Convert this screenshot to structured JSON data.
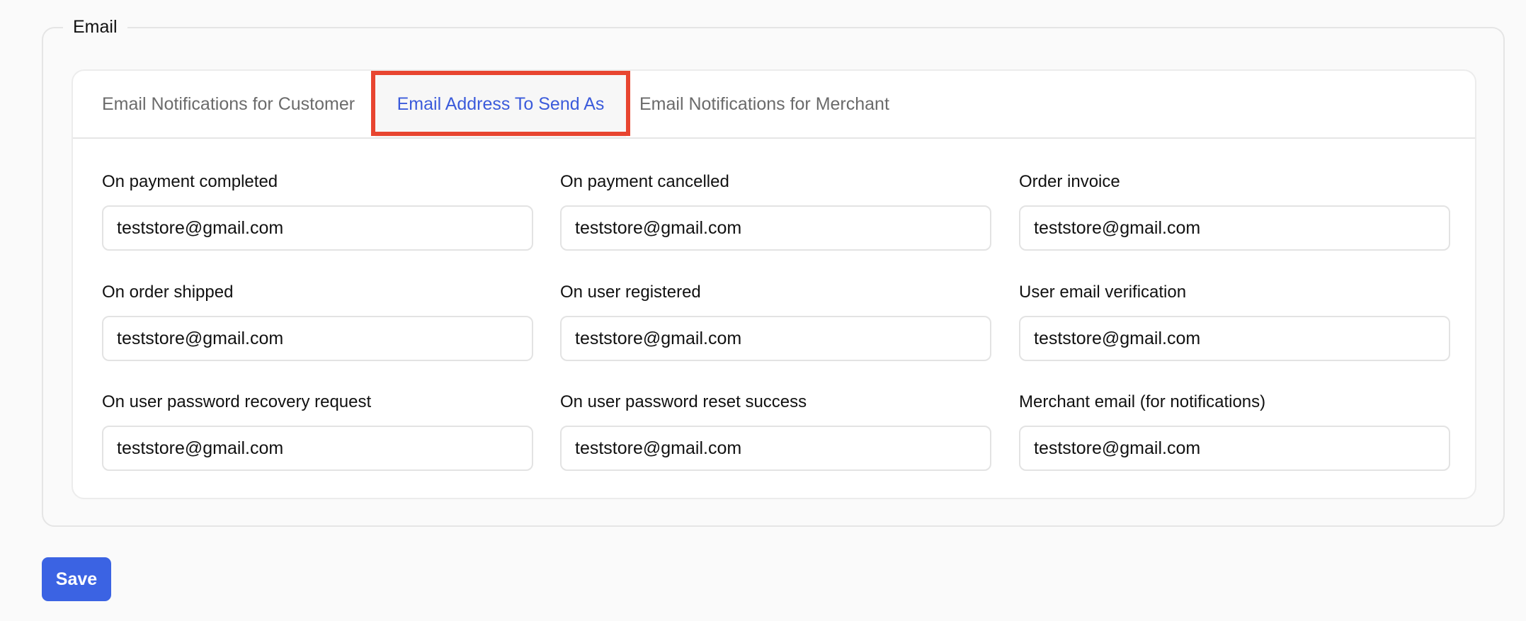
{
  "section": {
    "legend": "Email"
  },
  "tabs": [
    {
      "label": "Email Notifications for Customer",
      "active": false
    },
    {
      "label": "Email Address To Send As",
      "active": true
    },
    {
      "label": "Email Notifications for Merchant",
      "active": false
    }
  ],
  "fields": [
    {
      "label": "On payment completed",
      "value": "teststore@gmail.com"
    },
    {
      "label": "On payment cancelled",
      "value": "teststore@gmail.com"
    },
    {
      "label": "Order invoice",
      "value": "teststore@gmail.com"
    },
    {
      "label": "On order shipped",
      "value": "teststore@gmail.com"
    },
    {
      "label": "On user registered",
      "value": "teststore@gmail.com"
    },
    {
      "label": "User email verification",
      "value": "teststore@gmail.com"
    },
    {
      "label": "On user password recovery request",
      "value": "teststore@gmail.com"
    },
    {
      "label": "On user password reset success",
      "value": "teststore@gmail.com"
    },
    {
      "label": "Merchant email (for notifications)",
      "value": "teststore@gmail.com"
    }
  ],
  "actions": {
    "save_label": "Save"
  },
  "colors": {
    "accent": "#3b63e3",
    "active_tab_text": "#3b5bdb",
    "highlight_border": "#e84530",
    "inactive_tab_text": "#6b6b6b"
  }
}
